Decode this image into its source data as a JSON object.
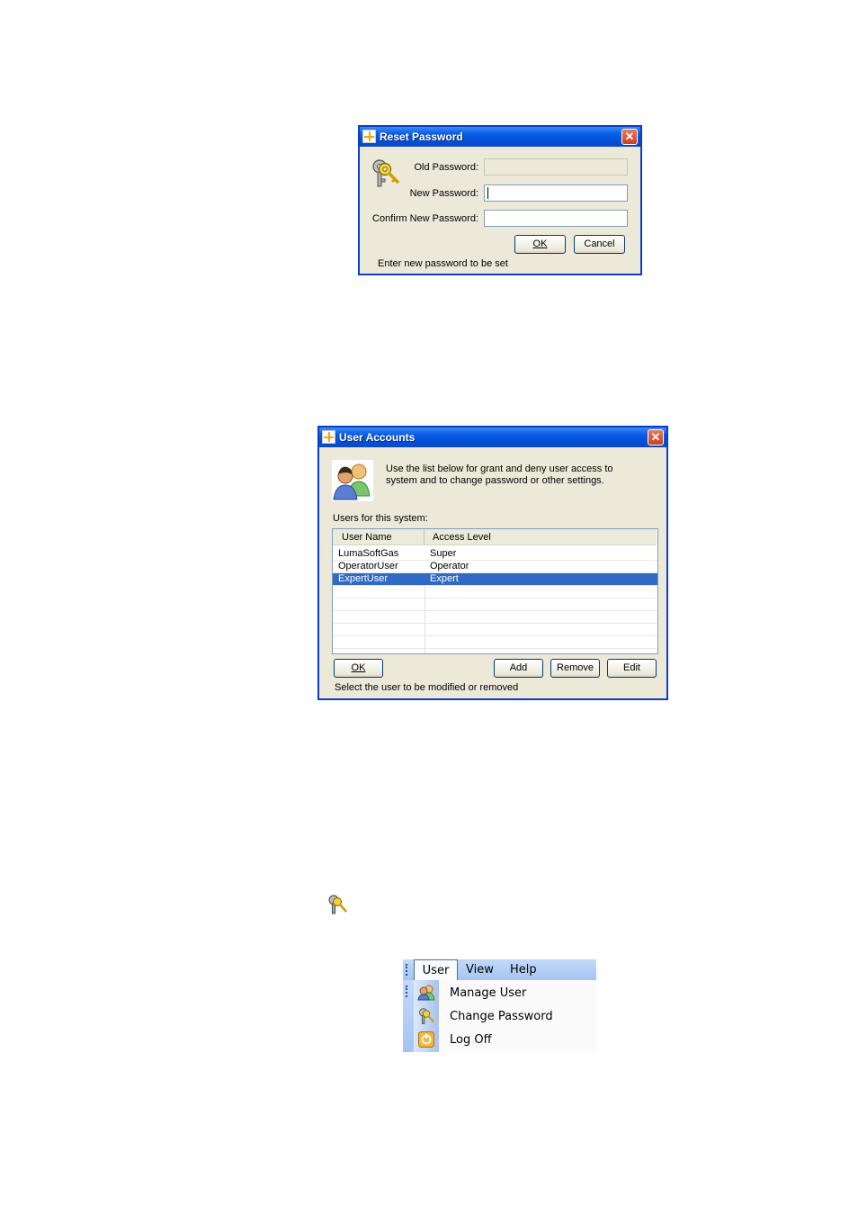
{
  "reset_dialog": {
    "title": "Reset Password",
    "old_password_label": "Old Password:",
    "new_password_label": "New Password:",
    "confirm_password_label": "Confirm New Password:",
    "old_password_value": "",
    "new_password_value": "",
    "confirm_password_value": "",
    "ok_label": "OK",
    "cancel_label": "Cancel",
    "status": "Enter new password to be set",
    "icon": "keys-icon"
  },
  "accounts_dialog": {
    "title": "User Accounts",
    "description_line1": "Use the list below for grant and deny user access to",
    "description_line2": "system and to change password or other settings.",
    "list_label": "Users for this system:",
    "columns": [
      "User Name",
      "Access Level"
    ],
    "rows": [
      {
        "user": "LumaSoftGas",
        "level": "Super"
      },
      {
        "user": "OperatorUser",
        "level": "Operator"
      },
      {
        "user": "ExpertUser",
        "level": "Expert",
        "selected": true
      }
    ],
    "ok_label": "OK",
    "add_label": "Add",
    "remove_label": "Remove",
    "edit_label": "Edit",
    "status": "Select the user to be modified or removed",
    "icon": "users-icon"
  },
  "toolbar_icon": "change-password-icon",
  "menu": {
    "items": [
      "User",
      "View",
      "Help"
    ],
    "dropdown": [
      {
        "label": "Manage User",
        "icon": "manage-user-icon"
      },
      {
        "label": "Change Password",
        "icon": "change-password-icon"
      },
      {
        "label": "Log Off",
        "icon": "log-off-icon"
      }
    ]
  },
  "colors": {
    "titlebar": "#0a5de6",
    "dialog_bg": "#ece9d8",
    "selection": "#316ac5",
    "close": "#c8401e"
  }
}
